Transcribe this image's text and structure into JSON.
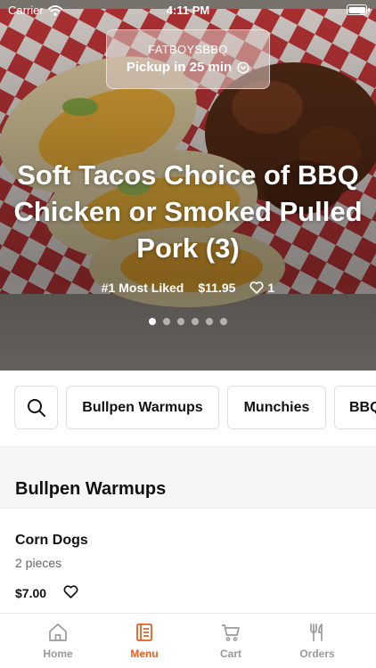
{
  "status_bar": {
    "carrier": "Carrier",
    "time": "4:11 PM"
  },
  "pickup": {
    "restaurant": "FATBOYSBBQ",
    "time_label": "Pickup in 25 min"
  },
  "featured": {
    "title": "Soft Tacos Choice of BBQ Chicken or Smoked Pulled Pork (3)",
    "badge": "#1 Most Liked",
    "price": "$11.95",
    "likes": "1",
    "carousel_pages": 6,
    "carousel_active": 1
  },
  "categories": {
    "search_icon": "search-icon",
    "chips": [
      "Bullpen Warmups",
      "Munchies",
      "BBQ"
    ]
  },
  "section": {
    "title": "Bullpen Warmups"
  },
  "items": [
    {
      "name": "Corn Dogs",
      "description": "2 pieces",
      "price": "$7.00"
    }
  ],
  "tabs": [
    {
      "label": "Home",
      "icon": "home-icon"
    },
    {
      "label": "Menu",
      "icon": "menu-icon"
    },
    {
      "label": "Cart",
      "icon": "cart-icon"
    },
    {
      "label": "Orders",
      "icon": "orders-icon"
    }
  ],
  "colors": {
    "accent": "#e85d1c"
  }
}
